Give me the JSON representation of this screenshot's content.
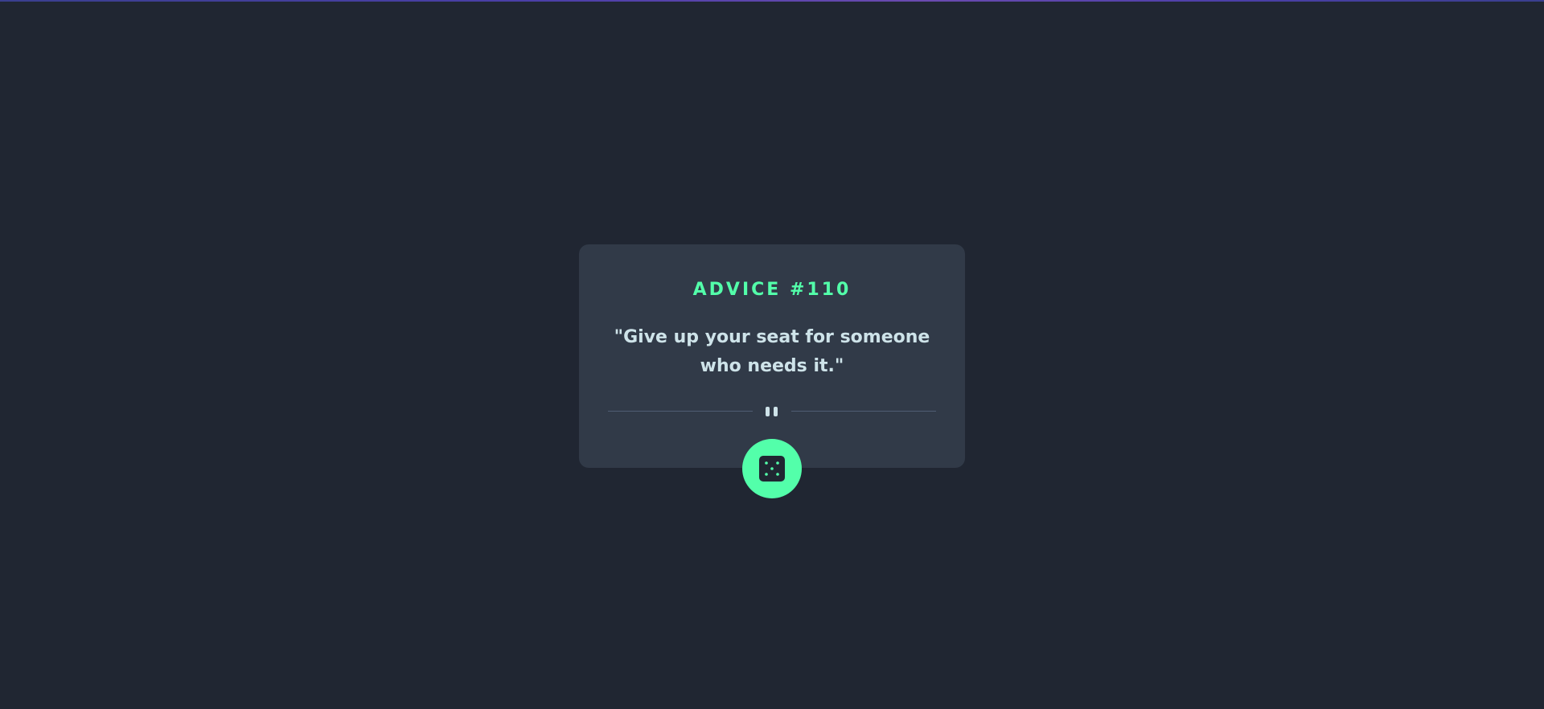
{
  "colors": {
    "background": "#202632",
    "card": "#313A48",
    "accent": "#53FFAA",
    "text": "#CEE3E9",
    "divider": "#4F5D74"
  },
  "card": {
    "heading": "ADVICE #110",
    "quote": "\"Give up your seat for someone who needs it.\""
  },
  "divider": {
    "icon": "pause-icon"
  },
  "button": {
    "icon": "dice-icon"
  }
}
